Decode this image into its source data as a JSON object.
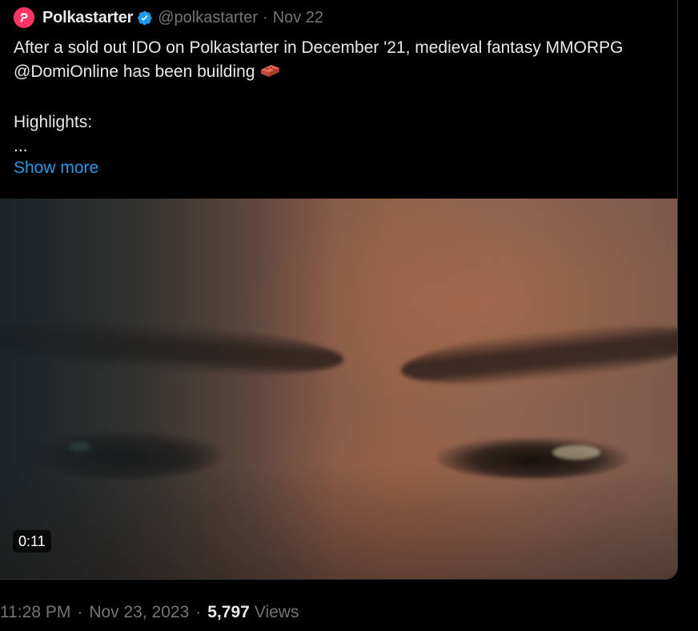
{
  "tweet": {
    "author_name": "Polkastarter",
    "handle": "@polkastarter",
    "separator": "·",
    "date": "Nov 22",
    "text_line_1": "After a sold out IDO on Polkastarter in December '21, medieval fantasy MMORPG @DomiOnline has been building",
    "emoji_name": "brick-icon",
    "text_line_2": "Highlights:",
    "text_line_3": "...",
    "show_more": "Show more",
    "video_duration": "0:11"
  },
  "meta": {
    "time": "11:28 PM",
    "separator_1": "·",
    "date": "Nov 23, 2023",
    "separator_2": "·",
    "views_count": "5,797",
    "views_label": "Views"
  },
  "colors": {
    "background": "#000000",
    "text_primary": "#e7e9ea",
    "text_secondary": "#71767b",
    "link": "#1d9bf0",
    "brand": "#ff3465",
    "verified_badge": "#1d9bf0"
  }
}
